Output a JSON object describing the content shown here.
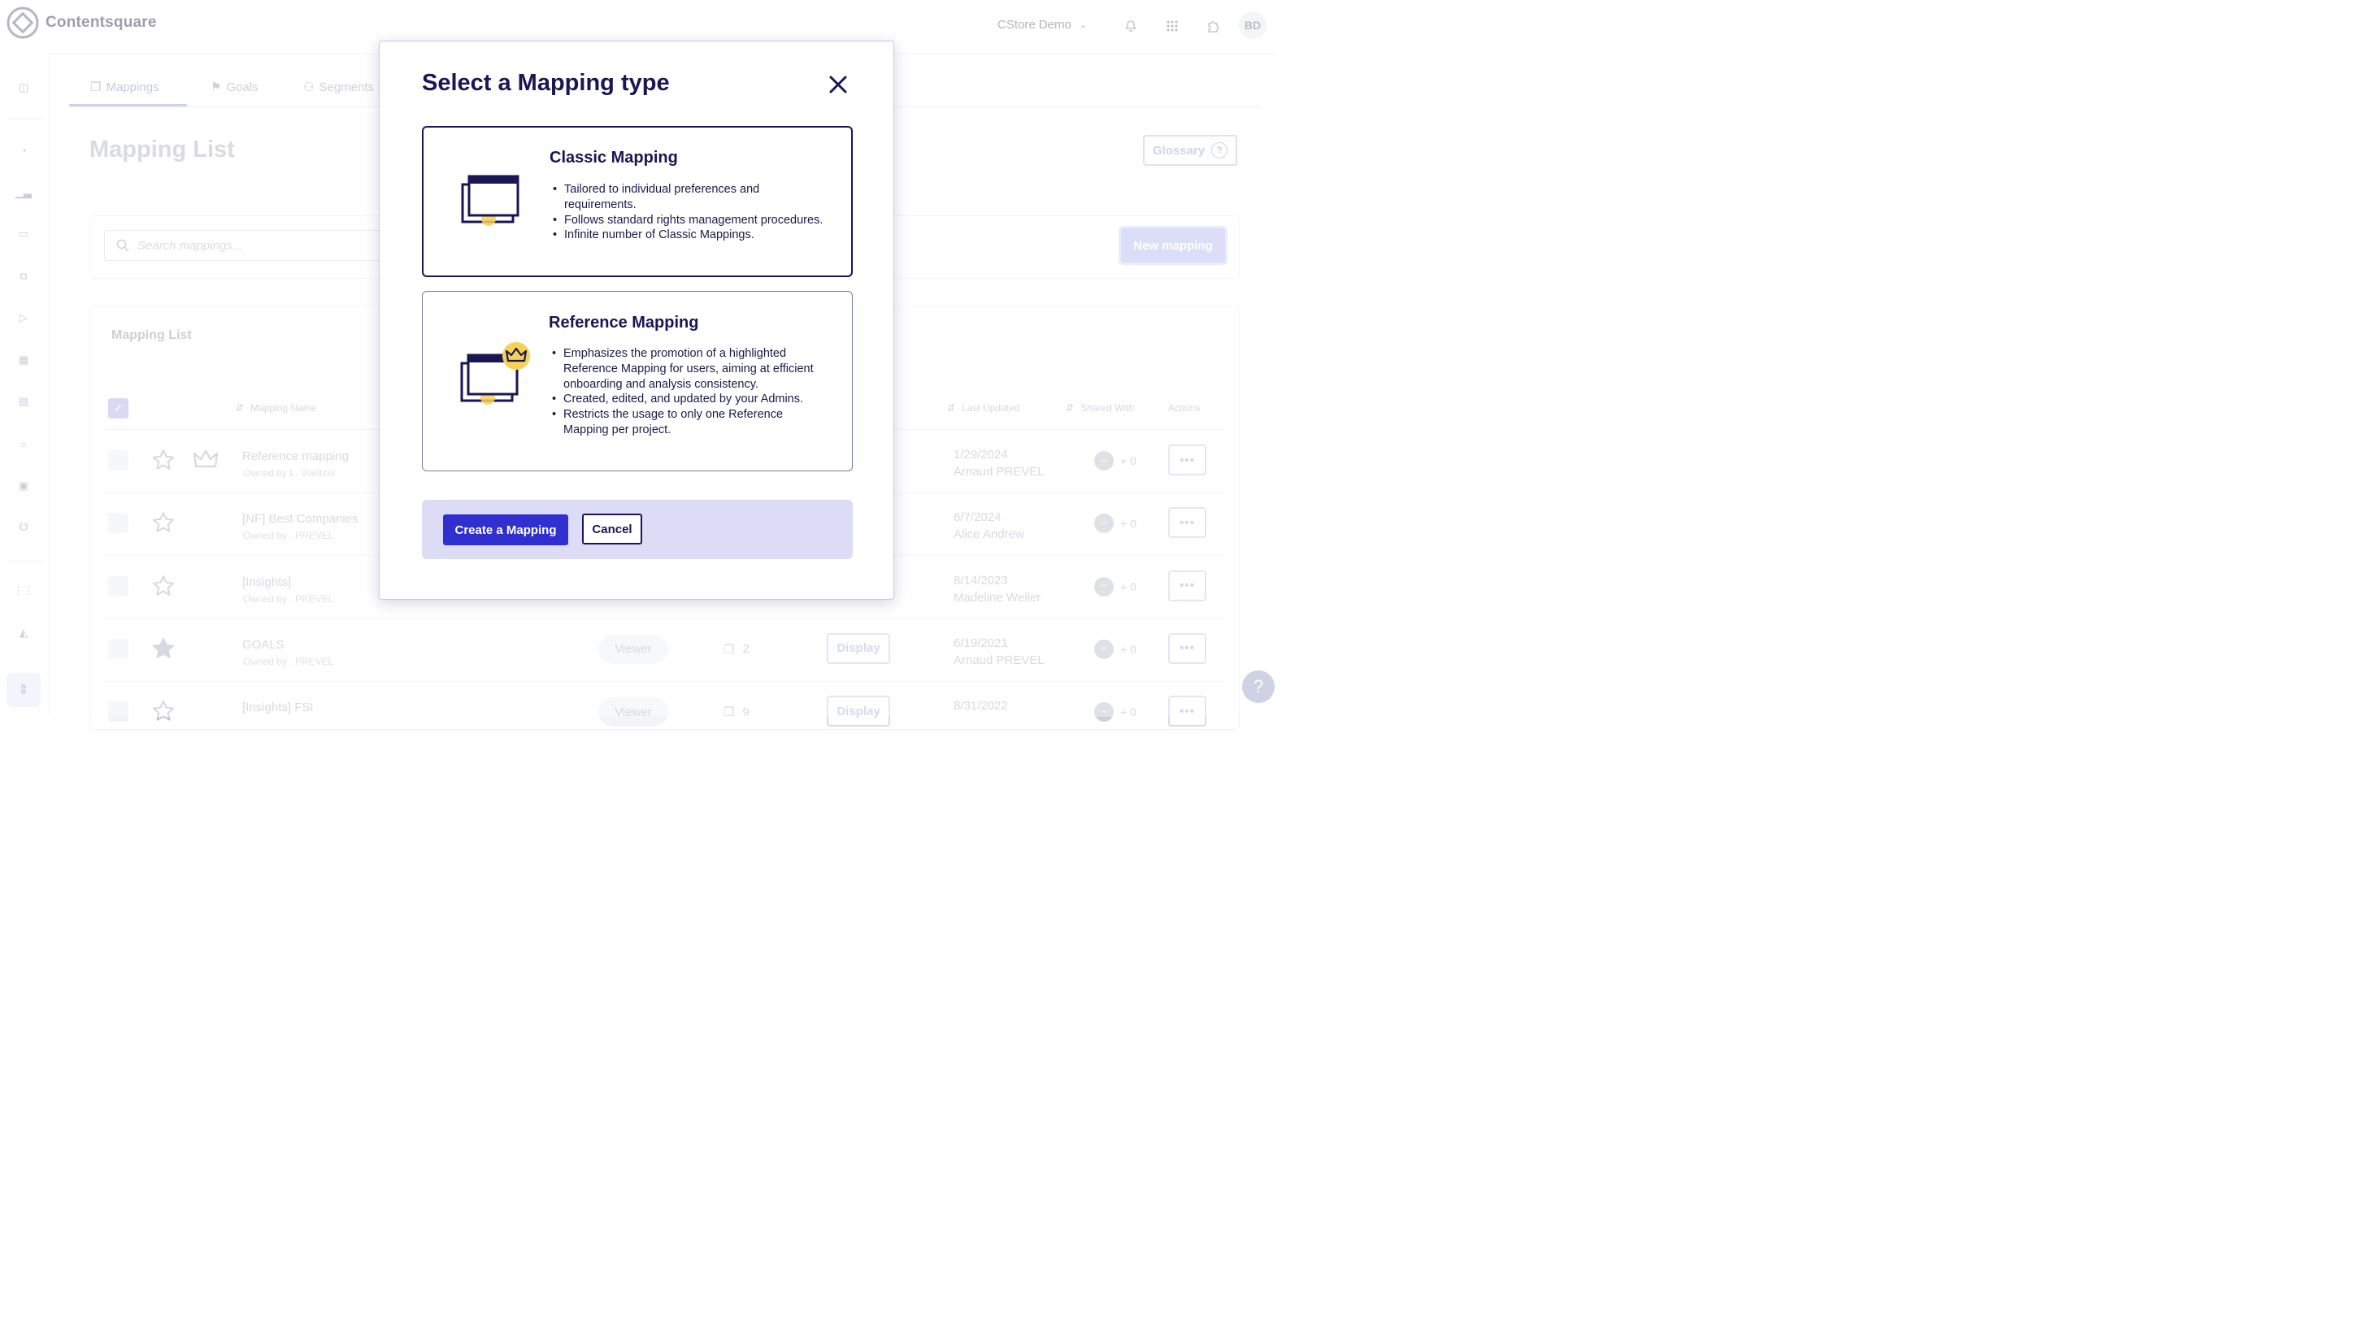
{
  "app": {
    "brand": "Contentsquare",
    "project": "CStore Demo",
    "user_initials": "BD"
  },
  "tabs": [
    {
      "label": "Mappings",
      "icon": "mapping-icon",
      "active": true
    },
    {
      "label": "Goals",
      "icon": "flag-icon",
      "active": false
    },
    {
      "label": "Segments",
      "icon": "users-icon",
      "active": false
    }
  ],
  "page": {
    "title": "Mapping List",
    "glossary_label": "Glossary",
    "new_mapping_label": "New mapping"
  },
  "search": {
    "placeholder": "Search mappings..."
  },
  "list": {
    "title": "Mapping List",
    "columns": {
      "name": "Mapping Name",
      "last_updated": "Last Updated",
      "shared_with": "Shared With",
      "actions": "Actions"
    },
    "rows": [
      {
        "name": "Reference mapping",
        "owner": "Owned by L. Voeltzel",
        "starred": false,
        "reference": true,
        "role": "",
        "count": "",
        "display": "",
        "date": "1/29/2024",
        "user": "Arnaud PREVEL",
        "share": "+ 0"
      },
      {
        "name": "[NF] Best Companies",
        "owner": "Owned by . PREVEL",
        "starred": false,
        "reference": false,
        "role": "",
        "count": "",
        "display": "",
        "date": "6/7/2024",
        "user": "Alice Andrew",
        "share": "+ 0"
      },
      {
        "name": "[Insights]",
        "owner": "Owned by . PREVEL",
        "starred": false,
        "reference": false,
        "role": "",
        "count": "",
        "display": "",
        "date": "8/14/2023",
        "user": "Madeline Weiler",
        "share": "+ 0"
      },
      {
        "name": "GOALS",
        "owner": "Owned by . PREVEL",
        "starred": true,
        "reference": false,
        "role": "Viewer",
        "count": "2",
        "display": "Display",
        "date": "6/19/2021",
        "user": "Arnaud PREVEL",
        "share": "+ 0"
      },
      {
        "name": "[Insights] FSI",
        "owner": "",
        "starred": false,
        "reference": false,
        "role": "Viewer",
        "count": "9",
        "display": "Display",
        "date": "8/31/2022",
        "user": "",
        "share": "+ 0"
      }
    ]
  },
  "modal": {
    "title": "Select a Mapping type",
    "options": [
      {
        "title": "Classic Mapping",
        "bullets": [
          "Tailored to individual preferences and requirements.",
          "Follows standard rights management procedures.",
          "Infinite number of Classic Mappings."
        ]
      },
      {
        "title": "Reference Mapping",
        "bullets": [
          "Emphasizes the promotion of a highlighted Reference Mapping for users, aiming at efficient onboarding and analysis consistency.",
          "Created, edited, and updated by your Admins.",
          "Restricts the usage to only one Reference Mapping per project."
        ]
      }
    ],
    "create_label": "Create a Mapping",
    "cancel_label": "Cancel"
  },
  "colors": {
    "primary": "#2f30cf",
    "navy": "#191654",
    "accent_yellow": "#f7d154",
    "footer_bg": "#dcdcf6"
  }
}
